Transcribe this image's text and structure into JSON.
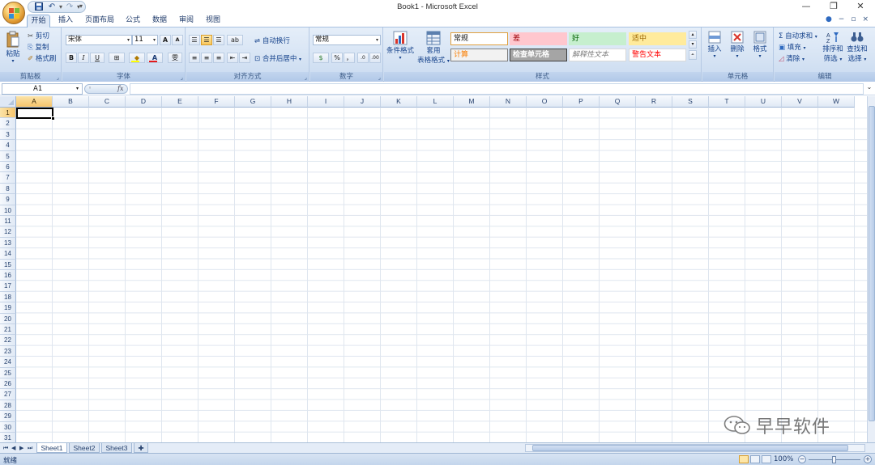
{
  "window": {
    "title": "Book1 - Microsoft Excel",
    "minimize": "—",
    "restore": "❐",
    "close": "✕"
  },
  "quick_access": {
    "save_icon": "save-icon",
    "undo_icon": "undo-icon",
    "redo_icon": "redo-icon",
    "customize": "▾"
  },
  "ribbon_tabs": [
    "开始",
    "插入",
    "页面布局",
    "公式",
    "数据",
    "审阅",
    "视图"
  ],
  "ribbon_tab_right": {
    "help": "●",
    "min": "−",
    "restore": "▫",
    "close": "×"
  },
  "clipboard": {
    "paste": "粘贴",
    "cut": "剪切",
    "copy": "复制",
    "format_painter": "格式刷",
    "label": "剪贴板"
  },
  "font": {
    "name": "宋体",
    "size": "11",
    "grow": "A",
    "shrink": "A",
    "bold": "B",
    "italic": "I",
    "underline": "U",
    "phonetic": "雯",
    "label": "字体"
  },
  "alignment": {
    "wrap_text": "自动换行",
    "merge_center": "合并后居中",
    "label": "对齐方式"
  },
  "number": {
    "format": "常规",
    "percent": "%",
    "comma": "，",
    "label": "数字"
  },
  "styles": {
    "conditional_format": "条件格式",
    "format_as_table_line1": "套用",
    "format_as_table_line2": "表格格式",
    "cells": [
      {
        "name": "常规",
        "bg": "#ffffff",
        "fg": "#111111",
        "border": "#e0a040"
      },
      {
        "name": "差",
        "bg": "#ffc7ce",
        "fg": "#9c0006",
        "border": "#ffc7ce"
      },
      {
        "name": "好",
        "bg": "#c6efce",
        "fg": "#006100",
        "border": "#c6efce"
      },
      {
        "name": "适中",
        "bg": "#ffeb9c",
        "fg": "#9c6500",
        "border": "#ffeb9c"
      },
      {
        "name": "计算",
        "bg": "#f2f2f2",
        "fg": "#fa7d00",
        "border": "#7f7f7f"
      },
      {
        "name": "检查单元格",
        "bg": "#a5a5a5",
        "fg": "#ffffff",
        "border": "#3f3f3f"
      },
      {
        "name": "解释性文本",
        "bg": "#ffffff",
        "fg": "#7f7f7f",
        "border": "#d9d9d9"
      },
      {
        "name": "警告文本",
        "bg": "#ffffff",
        "fg": "#ff0000",
        "border": "#d9d9d9"
      }
    ],
    "label": "样式"
  },
  "cells_group": {
    "insert": "插入",
    "delete": "删除",
    "format": "格式",
    "label": "单元格"
  },
  "editing": {
    "autosum": "自动求和",
    "fill": "填充",
    "clear": "清除",
    "sort_filter_line1": "排序和",
    "sort_filter_line2": "筛选",
    "find_select_line1": "查找和",
    "find_select_line2": "选择",
    "label": "编辑"
  },
  "formula_bar": {
    "name_box": "A1",
    "fx": "fx",
    "value": ""
  },
  "columns": [
    "A",
    "B",
    "C",
    "D",
    "E",
    "F",
    "G",
    "H",
    "I",
    "J",
    "K",
    "L",
    "M",
    "N",
    "O",
    "P",
    "Q",
    "R",
    "S",
    "T",
    "U",
    "V",
    "W"
  ],
  "rows": [
    "1",
    "2",
    "3",
    "4",
    "5",
    "6",
    "7",
    "8",
    "9",
    "10",
    "11",
    "12",
    "13",
    "14",
    "15",
    "16",
    "17",
    "18",
    "19",
    "20",
    "21",
    "22",
    "23",
    "24",
    "25",
    "26",
    "27",
    "28",
    "29",
    "30",
    "31"
  ],
  "active_cell": "A1",
  "sheets": [
    "Sheet1",
    "Sheet2",
    "Sheet3"
  ],
  "active_sheet": "Sheet1",
  "status": {
    "ready": "就绪",
    "zoom": "100%"
  },
  "watermark": "早早软件"
}
